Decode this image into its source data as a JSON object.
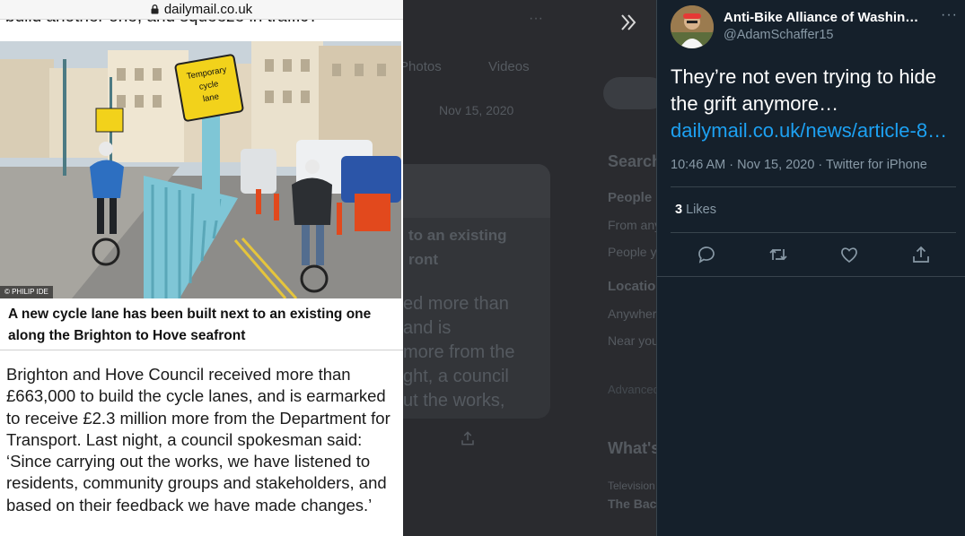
{
  "article": {
    "domain": "dailymail.co.uk",
    "cut_text": "build another one, and squeeze in traffic?",
    "photo_sign": [
      "Temporary",
      "cycle",
      "lane"
    ],
    "photo_credit": "© PHILIP IDE",
    "caption": "A new cycle lane has been built next to an existing one along the Brighton to Hove seafront",
    "body": "Brighton and Hove Council received more than £663,000 to build the cycle lanes, and is earmarked to receive £2.3 million more from the Department for Transport. Last night, a council spokesman said: ‘Since carrying out the works, we have listened to residents, community groups and stakeholders, and based on their feedback we have made changes.’"
  },
  "background": {
    "tab_photos": "Photos",
    "tab_videos": "Videos",
    "date_fragment": "Nov 15, 2020",
    "card_line1": "to an existing",
    "card_line2": "ront",
    "card_body": [
      "ed more than",
      "and is",
      "more from the",
      "ght, a council",
      "ut the works,"
    ],
    "search_heading": "Search filters",
    "people_label": "People",
    "from_anyone": "From anyone",
    "people_you_follow": "People you follow",
    "location_label": "Location",
    "anywhere": "Anywhere",
    "near_you": "Near you",
    "advanced": "Advanced search",
    "whats_happening": "What's happening",
    "trend_cat": "Television",
    "trend_title": "The Bachelor"
  },
  "tweet": {
    "display_name": "Anti-Bike Alliance of Washin…",
    "handle": "@AdamSchaffer15",
    "text": "They’re not even trying to hide the grift anymore…",
    "link": "dailymail.co.uk/news/article-8…",
    "timestamp": "10:46 AM · Nov 15, 2020 · Twitter for iPhone",
    "likes_count": "3",
    "likes_label": "Likes",
    "more_label": "···"
  },
  "colors": {
    "twitter_bg": "#15202b",
    "twitter_link": "#1da1f2",
    "twitter_muted": "#8899a6",
    "railing": "#7fc6d6"
  },
  "icons": [
    "lock-icon",
    "expand-icon",
    "reply-icon",
    "retweet-icon",
    "like-icon",
    "share-icon",
    "more-icon"
  ]
}
